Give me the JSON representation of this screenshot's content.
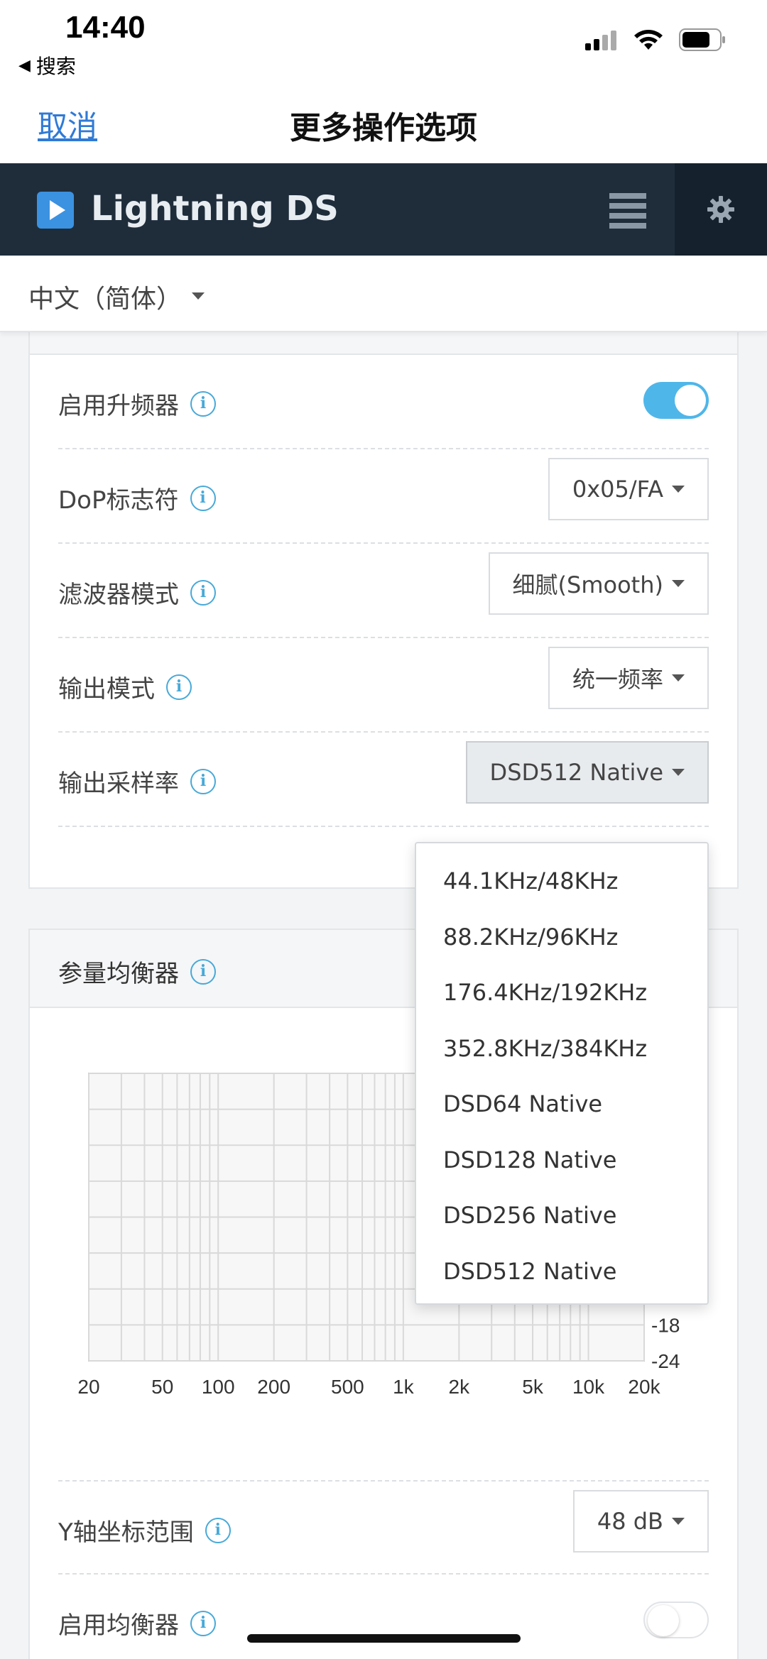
{
  "status_bar": {
    "time": "14:40",
    "back_app": "搜索"
  },
  "nav": {
    "cancel_label": "取消",
    "title": "更多操作选项"
  },
  "app": {
    "name": "Lightning DS"
  },
  "language": {
    "selected": "中文（简体）"
  },
  "upsampler": {
    "rows": [
      {
        "label": "启用升频器",
        "control": "toggle",
        "on": true
      },
      {
        "label": "DoP标志符",
        "control": "select",
        "value": "0x05/FA"
      },
      {
        "label": "滤波器模式",
        "control": "select",
        "value": "细腻(Smooth)"
      },
      {
        "label": "输出模式",
        "control": "select",
        "value": "统一频率"
      },
      {
        "label": "输出采样率",
        "control": "select",
        "value": "DSD512 Native"
      }
    ],
    "sample_rate_options": [
      "44.1KHz/48KHz",
      "88.2KHz/96KHz",
      "176.4KHz/192KHz",
      "352.8KHz/384KHz",
      "DSD64 Native",
      "DSD128 Native",
      "DSD256 Native",
      "DSD512 Native"
    ]
  },
  "equalizer": {
    "title": "参量均衡器",
    "y_range_label": "Y轴坐标范围",
    "y_range_value": "48 dB",
    "enable_label": "启用均衡器",
    "enabled": false
  },
  "chart_data": {
    "type": "line",
    "x_scale": "log",
    "x_ticks": [
      20,
      50,
      100,
      200,
      500,
      1000,
      2000,
      5000,
      10000,
      20000
    ],
    "x_tick_labels": [
      "20",
      "50",
      "100",
      "200",
      "500",
      "1k",
      "2k",
      "5k",
      "10k",
      "20k"
    ],
    "y_tick_labels": [
      "-18",
      "-24"
    ],
    "y_ticks": [
      -18,
      -24
    ],
    "ylim": [
      -24,
      24
    ],
    "grid": true,
    "series": []
  },
  "colors": {
    "header_bg": "#1f2d3b",
    "accent": "#4fb6e9",
    "link": "#2f7ad6",
    "logo": "#3b92e1"
  }
}
